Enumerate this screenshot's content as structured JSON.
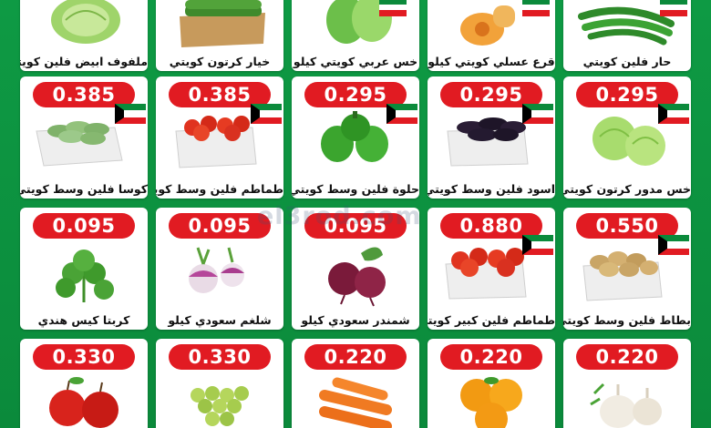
{
  "watermark": "el3rod.com",
  "colors": {
    "background": "#0c8f3e",
    "price_pill": "#e11b22",
    "card": "#ffffff"
  },
  "rows": [
    {
      "items": [
        {
          "name": "ملفوف ابيض فلين كويتي",
          "price": "",
          "icon": "cabbage"
        },
        {
          "name": "خيار كرتون كويتي",
          "price": "",
          "icon": "cucumber-box"
        },
        {
          "name": "خس عربي كويتي كيلو",
          "price": "",
          "icon": "romaine-lettuce"
        },
        {
          "name": "قرع عسلي كويتي كيلو",
          "price": "",
          "icon": "butternut-squash"
        },
        {
          "name": "حار فلين كويتي",
          "price": "",
          "icon": "green-chili"
        }
      ]
    },
    {
      "items": [
        {
          "name": "كوسا فلين وسط كويتي",
          "price": "0.385",
          "icon": "zucchini-box"
        },
        {
          "name": "طماطم فلين وسط كويتي",
          "price": "0.385",
          "icon": "tomato-box"
        },
        {
          "name": "حلوة فلين وسط كويتي",
          "price": "0.295",
          "icon": "green-pepper"
        },
        {
          "name": "اسود فلين وسط كويتي",
          "price": "0.295",
          "icon": "eggplant-box"
        },
        {
          "name": "خس مدور كرتون كويتي",
          "price": "0.295",
          "icon": "iceberg-lettuce"
        }
      ]
    },
    {
      "items": [
        {
          "name": "كربتا كيس هندي",
          "price": "0.095",
          "icon": "parsley"
        },
        {
          "name": "شلغم سعودي كيلو",
          "price": "0.095",
          "icon": "turnip"
        },
        {
          "name": "شمندر سعودي كيلو",
          "price": "0.095",
          "icon": "beetroot"
        },
        {
          "name": "طماطم فلين كبير كويتي",
          "price": "0.880",
          "icon": "tomato-box"
        },
        {
          "name": "بطاط فلين وسط كويتي",
          "price": "0.550",
          "icon": "potato-box"
        }
      ]
    },
    {
      "items": [
        {
          "name": "",
          "price": "0.330",
          "icon": "red-apple"
        },
        {
          "name": "",
          "price": "0.330",
          "icon": "green-grapes"
        },
        {
          "name": "",
          "price": "0.220",
          "icon": "carrot"
        },
        {
          "name": "",
          "price": "0.220",
          "icon": "orange"
        },
        {
          "name": "",
          "price": "0.220",
          "icon": "garlic"
        }
      ]
    }
  ]
}
